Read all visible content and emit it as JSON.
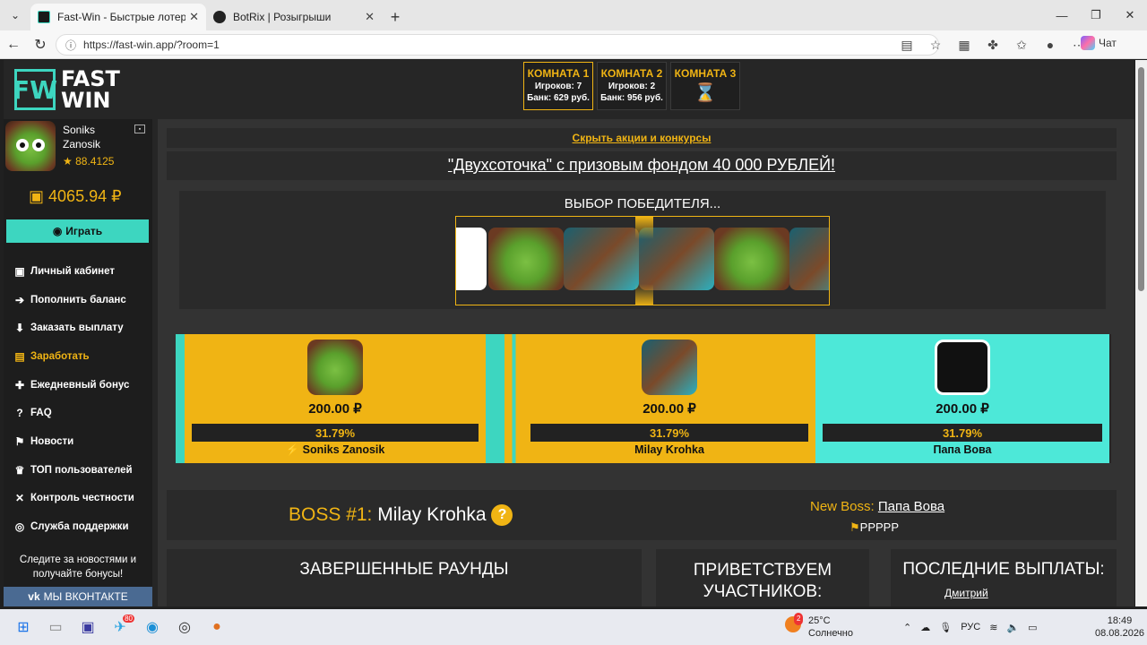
{
  "browser": {
    "tabs": [
      {
        "title": "Fast-Win - Быстрые лотереи! Ком",
        "active": true
      },
      {
        "title": "BotRix | Розыгрыши",
        "active": false
      }
    ],
    "url": "https://fast-win.app/?room=1",
    "chat_label": "Чат"
  },
  "site": {
    "logo": {
      "letters": "FW",
      "line1": "FAST",
      "line2": "WIN"
    },
    "rooms": [
      {
        "name": "КОМНАТА 1",
        "players": "Игроков: 7",
        "bank": "Банк: 629 руб.",
        "active": true
      },
      {
        "name": "КОМНАТА 2",
        "players": "Игроков: 2",
        "bank": "Банк: 956 руб.",
        "active": false
      },
      {
        "name": "КОМНАТА 3",
        "players": "",
        "bank": "",
        "active": false
      }
    ],
    "user": {
      "first": "Soniks",
      "last": "Zanosik",
      "rating": "★ 88.4125",
      "balance": "4065.94 ₽"
    },
    "play_label": "Играть",
    "menu": [
      {
        "label": "Личный кабинет",
        "icon": "briefcase-icon",
        "glyph": "▣"
      },
      {
        "label": "Пополнить баланс",
        "icon": "arrow-right-icon",
        "glyph": "➔"
      },
      {
        "label": "Заказать выплату",
        "icon": "arrow-down-icon",
        "glyph": "⬇"
      },
      {
        "label": "Заработать",
        "icon": "money-icon",
        "glyph": "▤",
        "gold": true
      },
      {
        "label": "Ежедневный бонус",
        "icon": "gift-icon",
        "glyph": "✚"
      },
      {
        "label": "FAQ",
        "icon": "question-icon",
        "glyph": "?"
      },
      {
        "label": "Новости",
        "icon": "bookmark-icon",
        "glyph": "⚑"
      },
      {
        "label": "ТОП пользователей",
        "icon": "trophy-icon",
        "glyph": "♛"
      },
      {
        "label": "Контроль честности",
        "icon": "shuffle-icon",
        "glyph": "✕"
      },
      {
        "label": "Служба поддержки",
        "icon": "support-icon",
        "glyph": "◎"
      }
    ],
    "follow_text": "Следите за новостями и получайте бонусы!",
    "vk_label": "МЫ ВКОНТАКТЕ",
    "hide_link": "Скрыть акции и конкурсы",
    "promo": "\"Двухсоточка\" с призовым фондом 40 000 РУБЛЕЙ!",
    "winner_title": "ВЫБОР ПОБЕДИТЕЛЯ...",
    "bets": [
      {
        "amount": "200.00 ₽",
        "percent": "31.79%",
        "name": "⚡ Soniks Zanosik",
        "color": "#f0b414"
      },
      {
        "amount": "200.00 ₽",
        "percent": "31.79%",
        "name": "Milay Krohka",
        "color": "#f0b414"
      },
      {
        "amount": "200.00 ₽",
        "percent": "31.79%",
        "name": "Папа Вова",
        "color": "#4de8d8"
      }
    ],
    "boss": {
      "prefix": "BOSS #1:",
      "name": "Milay Krohka",
      "new_prefix": "New Boss:",
      "new_name": "Папа Вова",
      "flags": "PPPPP"
    },
    "sections": {
      "rounds": "ЗАВЕРШЕННЫЕ РАУНДЫ",
      "greet": "ПРИВЕТСТВУЕМ УЧАСТНИКОВ:",
      "payouts": "ПОСЛЕДНИЕ ВЫПЛАТЫ:",
      "payout_name": "Дмитрий"
    }
  },
  "taskbar": {
    "weather_temp": "25°C",
    "weather_desc": "Солнечно",
    "lang": "РУС",
    "time": "18:49",
    "date": "08.08.2026",
    "telegram_badge": "80",
    "notif_badge": "2"
  }
}
